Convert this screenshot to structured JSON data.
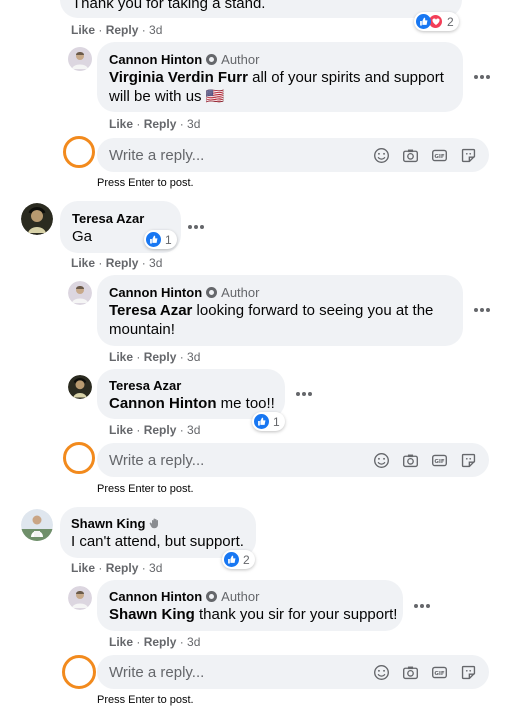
{
  "top_comment": {
    "text": "Thank you for taking a stand.",
    "actions": {
      "like": "Like",
      "reply": "Reply",
      "time": "3d"
    },
    "reaction_count": "2"
  },
  "reply1": {
    "author": "Cannon Hinton",
    "badge": "Author",
    "mention": "Virginia Verdin Furr",
    "text": " all of your spirits and support will be with us 🇺🇸",
    "actions": {
      "like": "Like",
      "reply": "Reply",
      "time": "3d"
    }
  },
  "reply_box_1": {
    "placeholder": "Write a reply...",
    "hint": "Press Enter to post."
  },
  "comment2": {
    "author": "Teresa Azar",
    "text": "Ga",
    "reaction_count": "1",
    "actions": {
      "like": "Like",
      "reply": "Reply",
      "time": "3d"
    }
  },
  "reply2": {
    "author": "Cannon Hinton",
    "badge": "Author",
    "mention": "Teresa Azar",
    "text": " looking forward to seeing you at the mountain!",
    "actions": {
      "like": "Like",
      "reply": "Reply",
      "time": "3d"
    }
  },
  "reply3": {
    "author": "Teresa Azar",
    "mention": "Cannon Hinton",
    "text": " me too!!",
    "reaction_count": "1",
    "actions": {
      "like": "Like",
      "reply": "Reply",
      "time": "3d"
    }
  },
  "reply_box_2": {
    "placeholder": "Write a reply...",
    "hint": "Press Enter to post."
  },
  "comment3": {
    "author": "Shawn King",
    "text": "I can't attend, but support.",
    "reaction_count": "2",
    "actions": {
      "like": "Like",
      "reply": "Reply",
      "time": "3d"
    }
  },
  "reply4": {
    "author": "Cannon Hinton",
    "badge": "Author",
    "mention": "Shawn King",
    "text": " thank you sir for your support!",
    "actions": {
      "like": "Like",
      "reply": "Reply",
      "time": "3d"
    }
  },
  "reply_box_3": {
    "placeholder": "Write a reply...",
    "hint": "Press Enter to post."
  },
  "colors": {
    "accent": "#1877f2",
    "love": "#f33e58",
    "bubble": "#f0f2f5",
    "muted": "#65676b",
    "highlight_ring": "#f28a1d"
  },
  "icons": [
    "like-icon",
    "love-icon",
    "emoji-icon",
    "camera-icon",
    "gif-icon",
    "sticker-icon",
    "more-options-icon",
    "author-badge-icon",
    "wave-icon"
  ]
}
